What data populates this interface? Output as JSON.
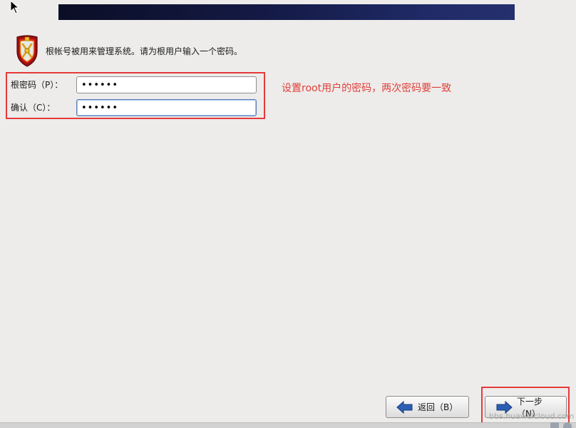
{
  "header": {
    "banner_color": "#141a45"
  },
  "intro": {
    "text": "根帐号被用来管理系统。请为根用户输入一个密码。",
    "icon": "shield-icon"
  },
  "form": {
    "root_password_label": "根密码（P）：",
    "root_password_value": "••••••",
    "confirm_label": "确认（C）：",
    "confirm_value": "••••••"
  },
  "annotation": {
    "text": "设置root用户的密码，两次密码要一致",
    "color": "#e0403a"
  },
  "buttons": {
    "back_label": "返回（B）",
    "back_icon": "arrow-left-icon",
    "next_label": "下一步（N）",
    "next_icon": "arrow-right-icon"
  },
  "watermark": {
    "text": "bbs.huaweicloud.com"
  },
  "colors": {
    "highlight": "#e53a3a",
    "background": "#edeceb",
    "arrow": "#2b5fb3"
  }
}
